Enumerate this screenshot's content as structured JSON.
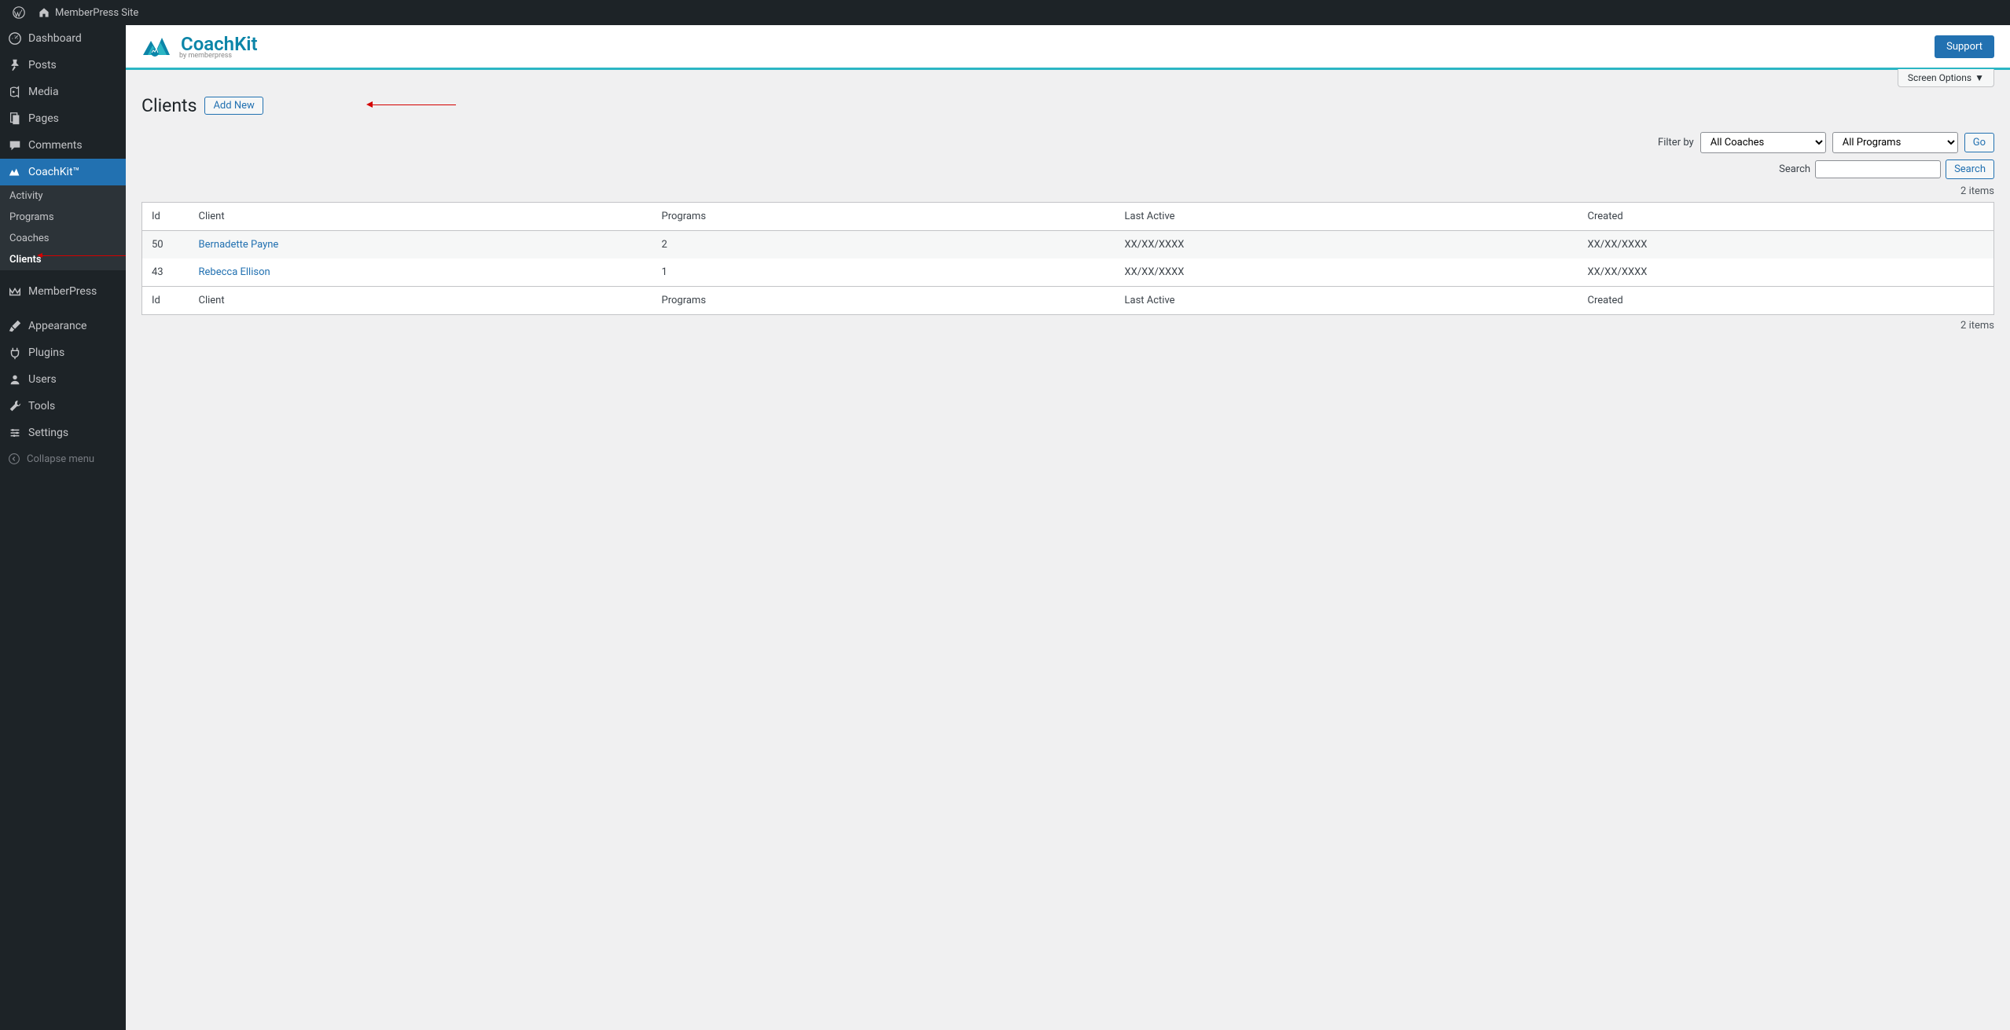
{
  "adminBar": {
    "siteName": "MemberPress Site"
  },
  "sidebar": {
    "items": [
      {
        "label": "Dashboard"
      },
      {
        "label": "Posts"
      },
      {
        "label": "Media"
      },
      {
        "label": "Pages"
      },
      {
        "label": "Comments"
      },
      {
        "label": "CoachKit™"
      },
      {
        "label": "MemberPress"
      },
      {
        "label": "Appearance"
      },
      {
        "label": "Plugins"
      },
      {
        "label": "Users"
      },
      {
        "label": "Tools"
      },
      {
        "label": "Settings"
      }
    ],
    "submenu": [
      {
        "label": "Activity"
      },
      {
        "label": "Programs"
      },
      {
        "label": "Coaches"
      },
      {
        "label": "Clients"
      }
    ],
    "collapse": "Collapse menu"
  },
  "header": {
    "logo": "CoachKit",
    "logoSub": "by memberpress",
    "support": "Support"
  },
  "screenOptions": "Screen Options",
  "page": {
    "title": "Clients",
    "addNew": "Add New"
  },
  "filters": {
    "label": "Filter by",
    "coaches": "All Coaches",
    "programs": "All Programs",
    "go": "Go",
    "searchLabel": "Search",
    "searchBtn": "Search"
  },
  "itemsCount": "2 items",
  "columns": {
    "id": "Id",
    "client": "Client",
    "programs": "Programs",
    "lastActive": "Last Active",
    "created": "Created"
  },
  "rows": [
    {
      "id": "50",
      "client": "Bernadette Payne",
      "programs": "2",
      "lastActive": "XX/XX/XXXX",
      "created": "XX/XX/XXXX"
    },
    {
      "id": "43",
      "client": "Rebecca Ellison",
      "programs": "1",
      "lastActive": "XX/XX/XXXX",
      "created": "XX/XX/XXXX"
    }
  ]
}
